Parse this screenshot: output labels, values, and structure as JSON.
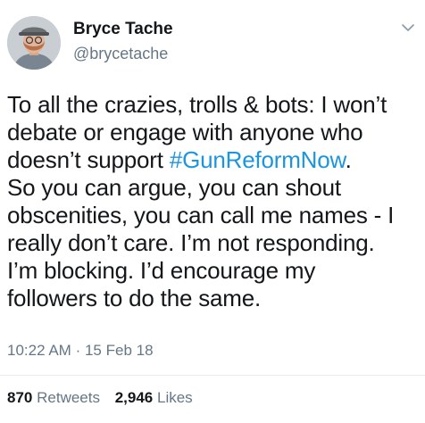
{
  "author": {
    "name": "Bryce Tache",
    "handle": "@brycetache"
  },
  "icons": {
    "menu": "chevron-down-icon",
    "avatar": "profile-avatar"
  },
  "tweet": {
    "lines": [
      "To all the crazies, trolls & bots: I won’t",
      "debate or engage with anyone who",
      "doesn’t support ",
      "So you can argue, you can shout",
      "obscenities, you can call me names - I",
      "really don’t care. I’m not responding.",
      "I’m blocking. I’d encourage my",
      "followers to do the same."
    ],
    "hashtag": "#GunReformNow",
    "hashtag_suffix": "."
  },
  "meta": {
    "time": "10:22 AM",
    "separator": "·",
    "date": "15 Feb 18"
  },
  "stats": {
    "retweets_count": "870",
    "retweets_label": "Retweets",
    "likes_count": "2,946",
    "likes_label": "Likes"
  },
  "colors": {
    "link": "#1b95e0",
    "secondary": "#657786",
    "text": "#14171a"
  }
}
